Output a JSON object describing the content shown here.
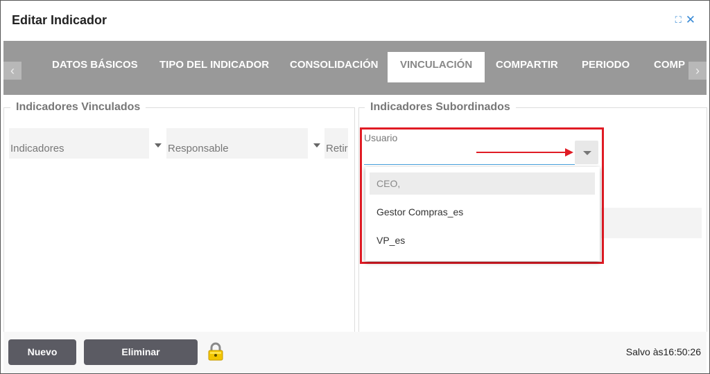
{
  "window": {
    "title": "Editar Indicador",
    "expand_icon": "expand-icon",
    "close_icon": "close-icon"
  },
  "tabs": [
    {
      "label": "DATOS BÁSICOS"
    },
    {
      "label": "TIPO DEL INDICADOR"
    },
    {
      "label": "CONSOLIDACIÓN"
    },
    {
      "label": "VINCULACIÓN"
    },
    {
      "label": "COMPARTIR"
    },
    {
      "label": "PERIODO"
    },
    {
      "label": "COMP"
    }
  ],
  "active_tab": "VINCULACIÓN",
  "left_panel": {
    "title": "Indicadores Vinculados",
    "columns": [
      "Indicadores",
      "Responsable",
      "Retira"
    ]
  },
  "right_panel": {
    "title": "Indicadores Subordinados",
    "usuario_label": "Usuario",
    "dropdown_options": [
      "CEO,",
      "Gestor Compras_es",
      "VP_es"
    ],
    "selected_option": "CEO,"
  },
  "footer": {
    "new_label": "Nuevo",
    "delete_label": "Eliminar",
    "lock_icon": "lock-icon",
    "saved_text": "Salvo às16:50:26"
  },
  "colors": {
    "tab_bar": "#999999",
    "button": "#5b5b63",
    "highlight": "#e01b24",
    "accent": "#3a8bd6"
  }
}
